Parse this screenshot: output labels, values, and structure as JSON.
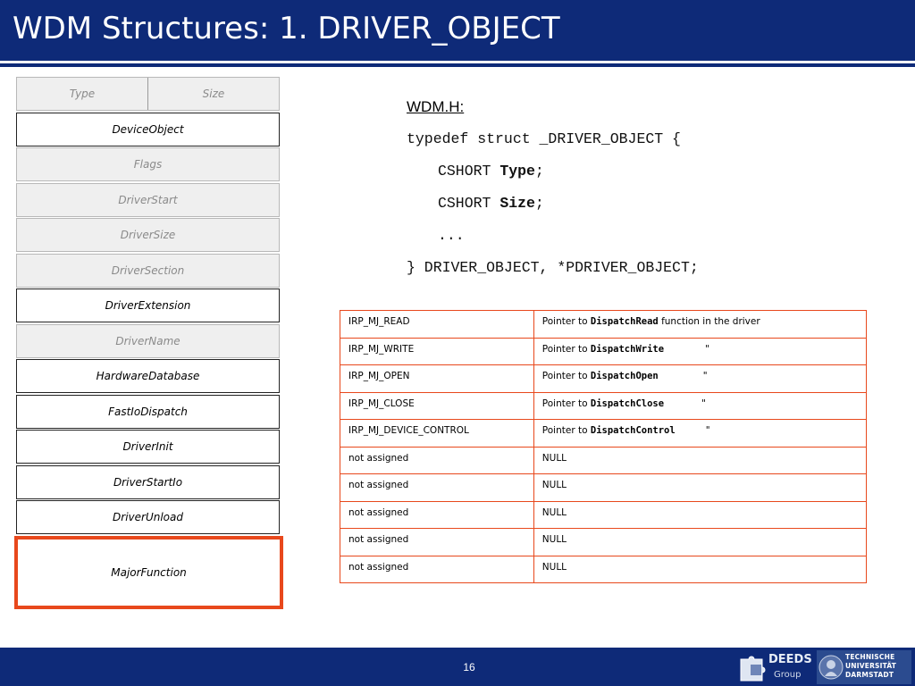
{
  "slide": {
    "title": "WDM Structures: 1. DRIVER_OBJECT",
    "page_number": "16"
  },
  "structure": {
    "header": {
      "left": "Type",
      "right": "Size"
    },
    "rows": [
      {
        "label": "DeviceObject",
        "style": "white"
      },
      {
        "label": "Flags",
        "style": "gray"
      },
      {
        "label": "DriverStart",
        "style": "gray"
      },
      {
        "label": "DriverSize",
        "style": "gray"
      },
      {
        "label": "DriverSection",
        "style": "gray"
      },
      {
        "label": "DriverExtension",
        "style": "white"
      },
      {
        "label": "DriverName",
        "style": "gray"
      },
      {
        "label": "HardwareDatabase",
        "style": "white"
      },
      {
        "label": "FastIoDispatch",
        "style": "white"
      },
      {
        "label": "DriverInit",
        "style": "white"
      },
      {
        "label": "DriverStartIo",
        "style": "white"
      },
      {
        "label": "DriverUnload",
        "style": "white"
      },
      {
        "label": "MajorFunction",
        "style": "highlight"
      }
    ],
    "highlight_color": "#e8481c"
  },
  "code": {
    "header": "WDM.H:",
    "line1": "typedef struct _DRIVER_OBJECT {",
    "line2_type": "CSHORT ",
    "line2_name": "Type",
    "line3_type": "CSHORT ",
    "line3_name": "Size",
    "semicolon": ";",
    "line4": "...",
    "line5": "} DRIVER_OBJECT, *PDRIVER_OBJECT;"
  },
  "irp_table": {
    "rows": [
      {
        "code": "IRP_MJ_READ",
        "prefix": "Pointer to ",
        "func": "DispatchRead",
        "suffix": " function in the driver"
      },
      {
        "code": "IRP_MJ_WRITE",
        "prefix": "Pointer to ",
        "func": "DispatchWrite",
        "suffix": "\""
      },
      {
        "code": "IRP_MJ_OPEN",
        "prefix": "Pointer to ",
        "func": "DispatchOpen",
        "suffix": "\""
      },
      {
        "code": "IRP_MJ_CLOSE",
        "prefix": "Pointer to ",
        "func": "DispatchClose",
        "suffix": "\""
      },
      {
        "code": "IRP_MJ_DEVICE_CONTROL",
        "prefix": "Pointer to ",
        "func": "DispatchControl",
        "suffix": "\""
      },
      {
        "code": "not assigned",
        "value": "NULL"
      },
      {
        "code": "not assigned",
        "value": "NULL"
      },
      {
        "code": "not assigned",
        "value": "NULL"
      },
      {
        "code": "not assigned",
        "value": "NULL"
      },
      {
        "code": "not assigned",
        "value": "NULL"
      }
    ]
  },
  "footer": {
    "deeds_logo": "DEEDS",
    "deeds_sub": "Group",
    "tud_line1": "TECHNISCHE",
    "tud_line2": "UNIVERSITÄT",
    "tud_line3": "DARMSTADT"
  },
  "colors": {
    "brand_blue": "#0e2a78",
    "accent_orange": "#e8481c"
  }
}
